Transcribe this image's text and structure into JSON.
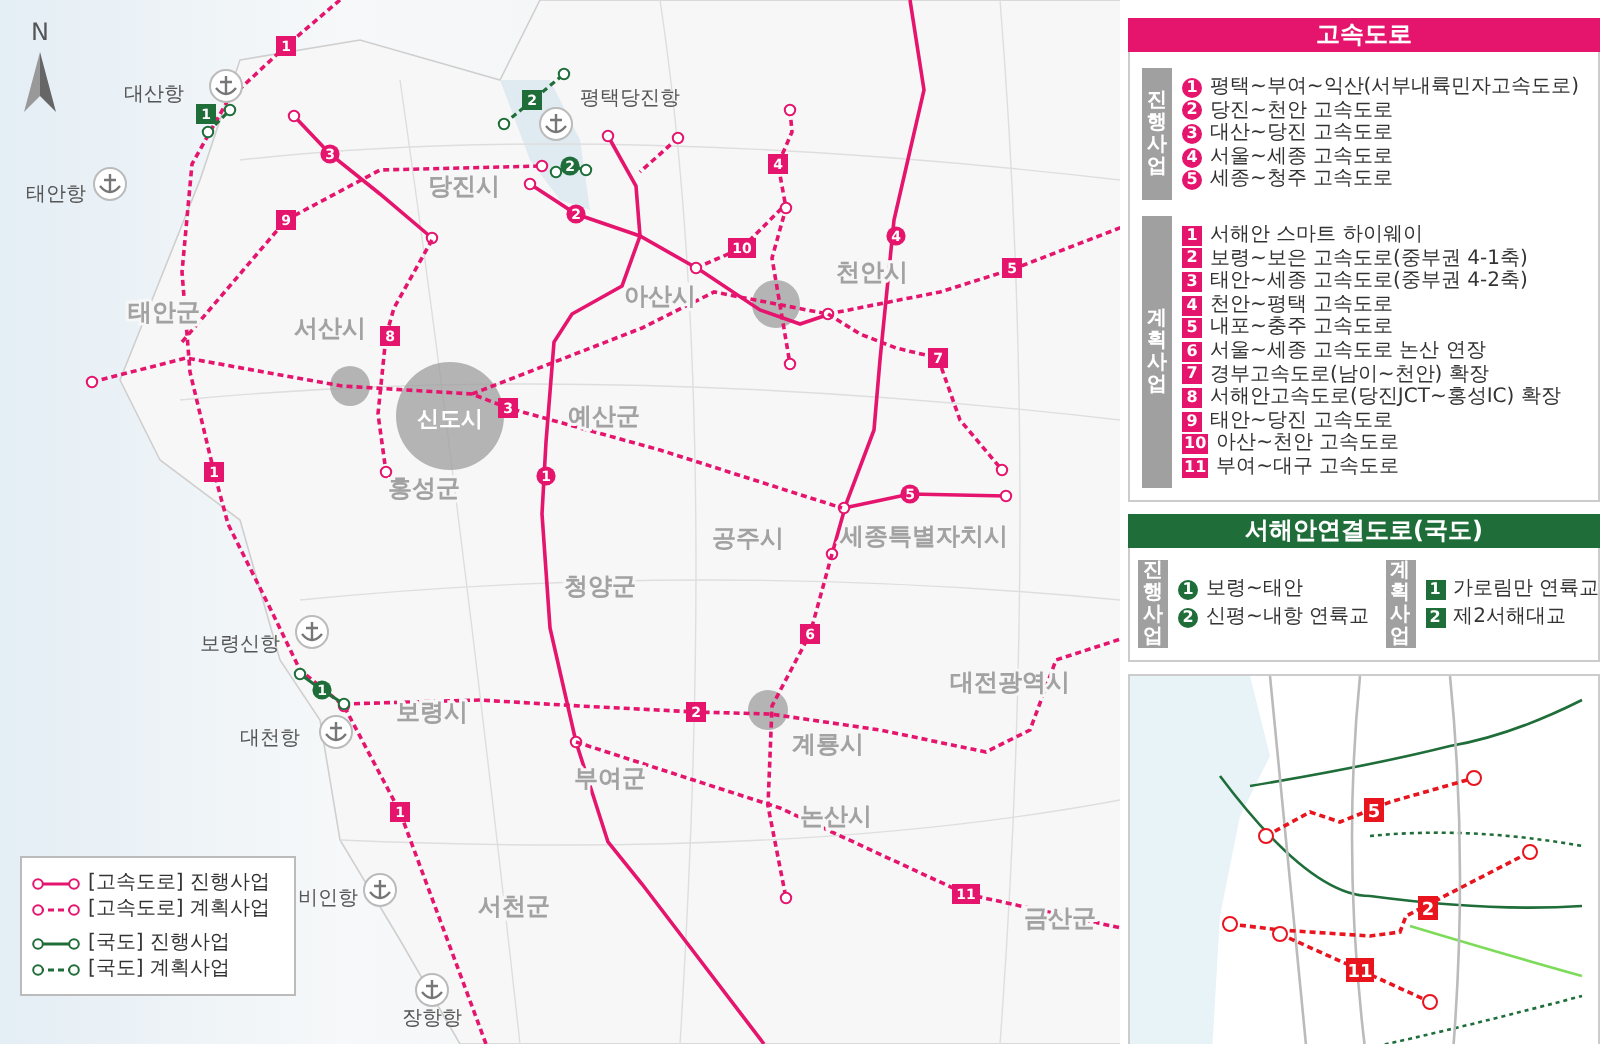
{
  "map": {
    "compass": "N",
    "cities": [
      "태안군",
      "서산시",
      "당진시",
      "아산시",
      "천안시",
      "예산군",
      "홍성군",
      "신도시",
      "공주시",
      "세종특별자치시",
      "청양군",
      "보령시",
      "대전광역시",
      "부여군",
      "계룡시",
      "논산시",
      "서천군",
      "금산군"
    ],
    "ports": [
      "대산항",
      "평택당진항",
      "태안항",
      "보령신항",
      "대천항",
      "비인항",
      "장항항"
    ],
    "routes": [
      {
        "kind": "expressway",
        "planned": false,
        "markers": [
          "1"
        ]
      },
      {
        "kind": "expressway",
        "planned": false,
        "markers": [
          "2"
        ]
      },
      {
        "kind": "expressway",
        "planned": false,
        "markers": [
          "3"
        ]
      },
      {
        "kind": "expressway",
        "planned": false,
        "markers": [
          "4"
        ]
      },
      {
        "kind": "expressway",
        "planned": false,
        "markers": [
          "5"
        ]
      },
      {
        "kind": "expressway",
        "planned": true,
        "markers": [
          "1",
          "1",
          "1"
        ]
      },
      {
        "kind": "expressway",
        "planned": true,
        "markers": [
          "2"
        ]
      },
      {
        "kind": "expressway",
        "planned": true,
        "markers": [
          "3"
        ]
      },
      {
        "kind": "expressway",
        "planned": true,
        "markers": [
          "4"
        ]
      },
      {
        "kind": "expressway",
        "planned": true,
        "markers": [
          "5"
        ]
      },
      {
        "kind": "expressway",
        "planned": true,
        "markers": [
          "6"
        ]
      },
      {
        "kind": "expressway",
        "planned": true,
        "markers": [
          "7"
        ]
      },
      {
        "kind": "expressway",
        "planned": true,
        "markers": [
          "8"
        ]
      },
      {
        "kind": "expressway",
        "planned": true,
        "markers": [
          "9"
        ]
      },
      {
        "kind": "expressway",
        "planned": true,
        "markers": [
          "10"
        ]
      },
      {
        "kind": "expressway",
        "planned": true,
        "markers": [
          "11"
        ]
      },
      {
        "kind": "national",
        "planned": false,
        "markers": [
          "1"
        ]
      },
      {
        "kind": "national",
        "planned": false,
        "markers": [
          "2"
        ]
      },
      {
        "kind": "national",
        "planned": true,
        "markers": [
          "1"
        ]
      },
      {
        "kind": "national",
        "planned": true,
        "markers": [
          "2"
        ]
      }
    ],
    "legend": [
      {
        "label": "[고속도로] 진행사업",
        "kind": "expressway",
        "planned": false
      },
      {
        "label": "[고속도로] 계획사업",
        "kind": "expressway",
        "planned": true
      },
      {
        "label": "[국도] 진행사업",
        "kind": "national",
        "planned": false
      },
      {
        "label": "[국도] 계획사업",
        "kind": "national",
        "planned": true
      }
    ]
  },
  "expressway_panel": {
    "title": "고속도로",
    "groups": [
      {
        "label": "진행사업",
        "planned": false,
        "items": [
          {
            "number": "1",
            "name": "평택~부여~익산(서부내륙민자고속도로)"
          },
          {
            "number": "2",
            "name": "당진~천안 고속도로"
          },
          {
            "number": "3",
            "name": "대산~당진 고속도로"
          },
          {
            "number": "4",
            "name": "서울~세종 고속도로"
          },
          {
            "number": "5",
            "name": "세종~청주 고속도로"
          }
        ]
      },
      {
        "label": "계획사업",
        "planned": true,
        "items": [
          {
            "number": "1",
            "name": "서해안 스마트 하이웨이"
          },
          {
            "number": "2",
            "name": "보령~보은 고속도로(중부권 4-1축)"
          },
          {
            "number": "3",
            "name": "태안~세종 고속도로(중부권 4-2축)"
          },
          {
            "number": "4",
            "name": "천안~평택 고속도로"
          },
          {
            "number": "5",
            "name": "내포~충주 고속도로"
          },
          {
            "number": "6",
            "name": "서울~세종 고속도로 논산 연장"
          },
          {
            "number": "7",
            "name": "경부고속도로(남이~천안) 확장"
          },
          {
            "number": "8",
            "name": "서해안고속도로(당진JCT~홍성IC) 확장"
          },
          {
            "number": "9",
            "name": "태안~당진 고속도로"
          },
          {
            "number": "10",
            "name": "아산~천안 고속도로"
          },
          {
            "number": "11",
            "name": "부여~대구 고속도로"
          }
        ]
      }
    ]
  },
  "national_panel": {
    "title": "서해안연결도로(국도)",
    "groups": [
      {
        "label": "진행사업",
        "planned": false,
        "items": [
          {
            "number": "1",
            "name": "보령~태안"
          },
          {
            "number": "2",
            "name": "신평~내항 연륙교"
          }
        ]
      },
      {
        "label": "계획사업",
        "planned": true,
        "items": [
          {
            "number": "1",
            "name": "가로림만 연륙교"
          },
          {
            "number": "2",
            "name": "제2서해대교"
          }
        ]
      }
    ]
  },
  "inset_map": {
    "markers": [
      "5",
      "2",
      "11"
    ]
  }
}
